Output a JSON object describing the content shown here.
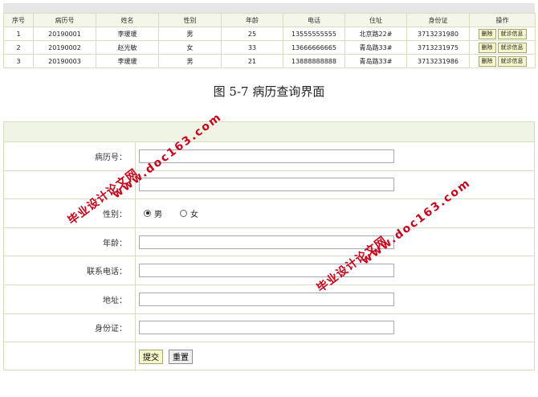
{
  "table": {
    "headers": [
      "序号",
      "病历号",
      "姓名",
      "性别",
      "年龄",
      "电话",
      "住址",
      "身份证",
      "操作"
    ],
    "rows": [
      {
        "no": "1",
        "record": "20190001",
        "name": "李瑗瑗",
        "gender": "男",
        "age": "25",
        "phone": "13555555555",
        "address": "北京路22#",
        "id_card": "3713231980"
      },
      {
        "no": "2",
        "record": "20190002",
        "name": "赵光敏",
        "gender": "女",
        "age": "33",
        "phone": "13666666665",
        "address": "青岛路33#",
        "id_card": "3713231975"
      },
      {
        "no": "3",
        "record": "20190003",
        "name": "李瑗瑗",
        "gender": "男",
        "age": "21",
        "phone": "13888888888",
        "address": "青岛路33#",
        "id_card": "3713231986"
      }
    ],
    "delete_label": "删除",
    "visit_label": "就诊信息"
  },
  "caption": "图 5-7 病历查询界面",
  "form": {
    "record_label": "病历号：",
    "name_label": "：",
    "gender_label": "性别：",
    "gender_male": "男",
    "gender_female": "女",
    "age_label": "年龄：",
    "phone_label": "联系电话：",
    "address_label": "地址：",
    "id_label": "身份证：",
    "submit_label": "提交",
    "reset_label": "重置"
  },
  "watermarks": {
    "url": "www.doc163.com",
    "name": "毕业设计论文网"
  }
}
